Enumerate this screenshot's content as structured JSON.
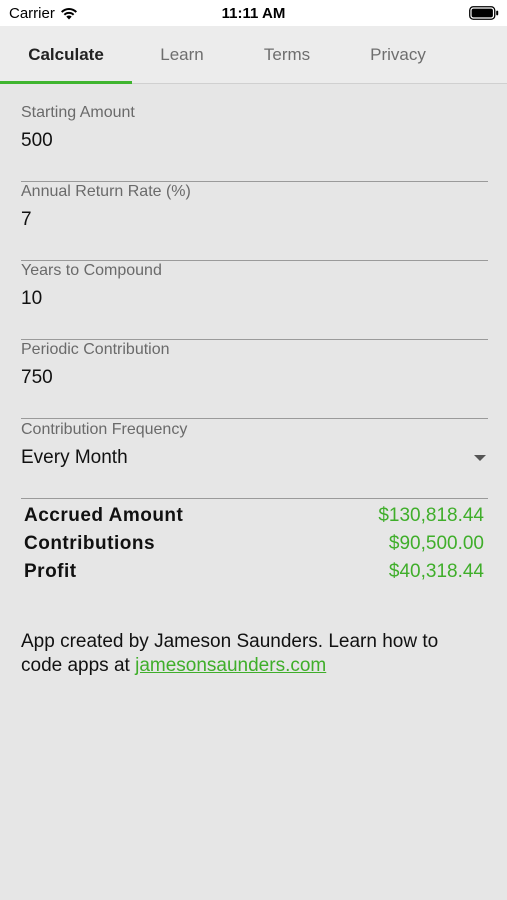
{
  "status_bar": {
    "carrier": "Carrier",
    "time": "11:11 AM"
  },
  "tabs": [
    {
      "label": "Calculate",
      "active": true
    },
    {
      "label": "Learn",
      "active": false
    },
    {
      "label": "Terms",
      "active": false
    },
    {
      "label": "Privacy",
      "active": false
    }
  ],
  "form": {
    "starting_amount": {
      "label": "Starting Amount",
      "value": "500"
    },
    "annual_return_rate": {
      "label": "Annual Return Rate (%)",
      "value": "7"
    },
    "years_to_compound": {
      "label": "Years to Compound",
      "value": "10"
    },
    "periodic_contribution": {
      "label": "Periodic Contribution",
      "value": "750"
    },
    "contribution_frequency": {
      "label": "Contribution Frequency",
      "value": "Every Month"
    }
  },
  "results": {
    "accrued_amount": {
      "label": "Accrued Amount",
      "value": "$130,818.44"
    },
    "contributions": {
      "label": "Contributions",
      "value": "$90,500.00"
    },
    "profit": {
      "label": "Profit",
      "value": "$40,318.44"
    }
  },
  "footer": {
    "text": "App created by Jameson Saunders. Learn how to code apps at ",
    "link_text": "jamesonsaunders.com"
  },
  "colors": {
    "accent": "#3fb52f",
    "result_green": "#3fae2a",
    "background": "#e6e6e6"
  }
}
